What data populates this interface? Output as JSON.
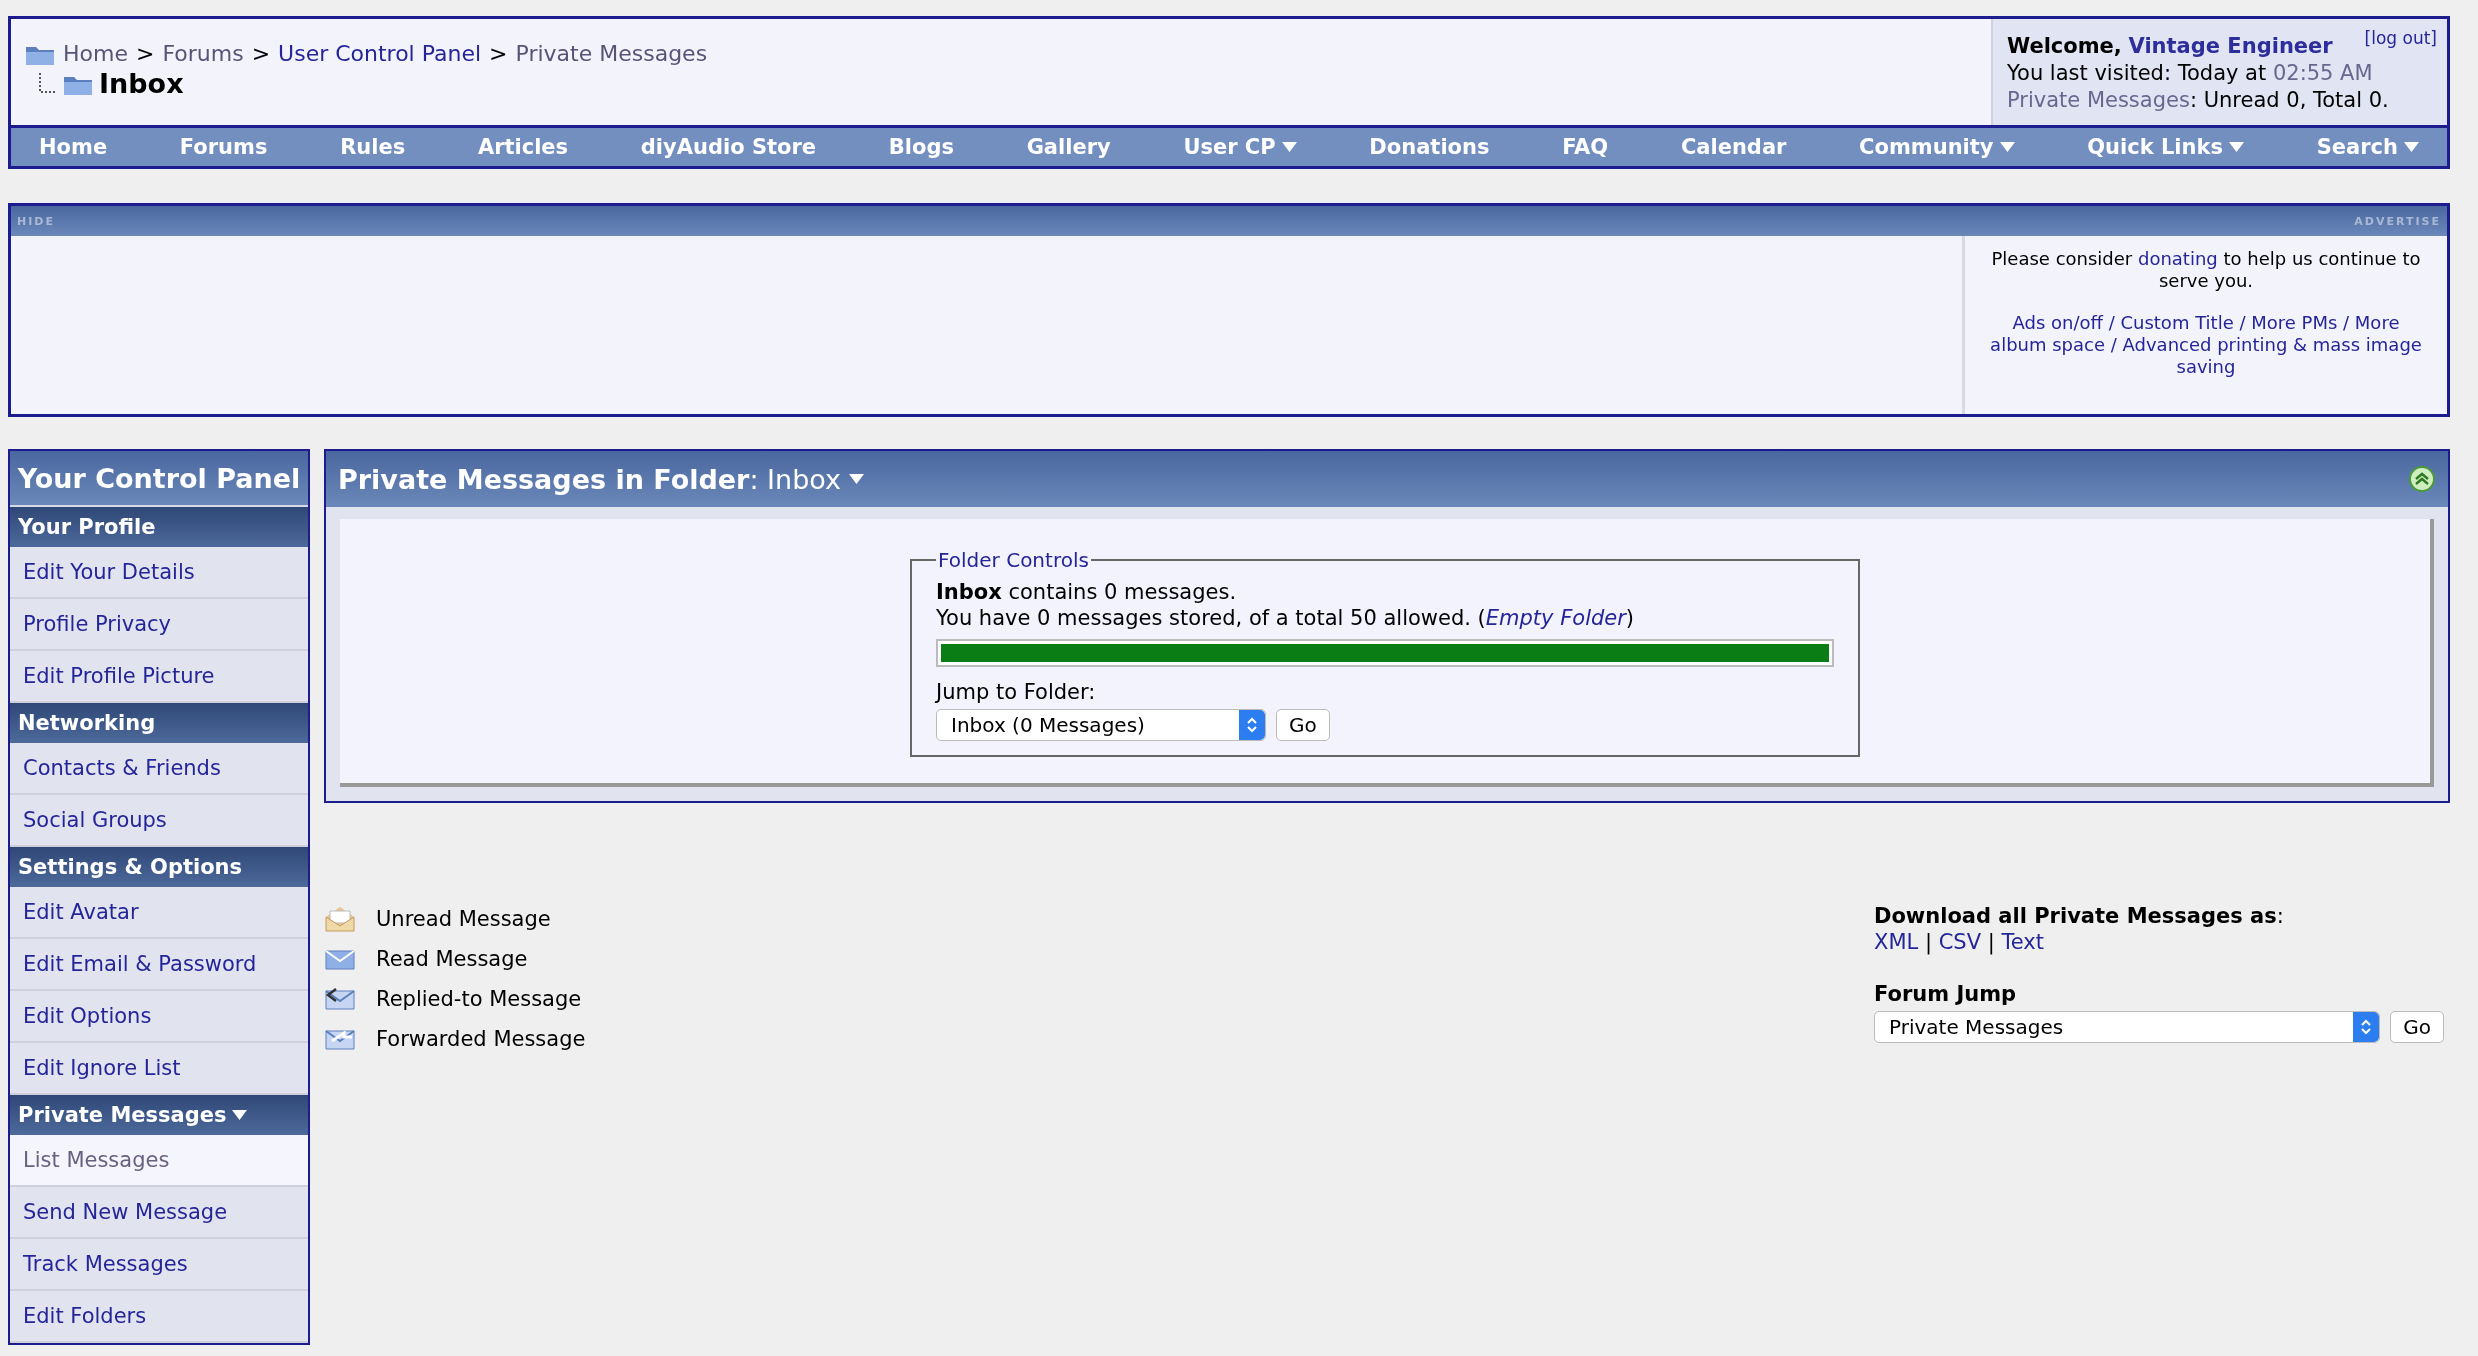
{
  "breadcrumb": {
    "separator": ">",
    "items": [
      {
        "label": "Home",
        "visited": true
      },
      {
        "label": "Forums",
        "visited": true
      },
      {
        "label": "User Control Panel",
        "visited": false
      },
      {
        "label": "Private Messages",
        "visited": true
      }
    ],
    "page_title": "Inbox"
  },
  "welcome": {
    "greeting": "Welcome,",
    "name": "Vintage Engineer",
    "logout": "[log out]",
    "last_visited": "You last visited: Today at",
    "time": "02:55 AM",
    "pm_link": "Private Messages",
    "pm_status": ": Unread 0, Total 0."
  },
  "nav": [
    {
      "label": "Home",
      "dropdown": false
    },
    {
      "label": "Forums",
      "dropdown": false
    },
    {
      "label": "Rules",
      "dropdown": false
    },
    {
      "label": "Articles",
      "dropdown": false
    },
    {
      "label": "diyAudio Store",
      "dropdown": false
    },
    {
      "label": "Blogs",
      "dropdown": false
    },
    {
      "label": "Gallery",
      "dropdown": false
    },
    {
      "label": "User CP",
      "dropdown": true
    },
    {
      "label": "Donations",
      "dropdown": false
    },
    {
      "label": "FAQ",
      "dropdown": false
    },
    {
      "label": "Calendar",
      "dropdown": false
    },
    {
      "label": "Community",
      "dropdown": true
    },
    {
      "label": "Quick Links",
      "dropdown": true
    },
    {
      "label": "Search",
      "dropdown": true
    }
  ],
  "ad": {
    "hide": "HIDE",
    "advertise": "ADVERTISE",
    "donate_before": "Please consider ",
    "donate_link": "donating",
    "donate_after": " to help us continue to serve you.",
    "perks": "Ads on/off / Custom Title / More PMs / More album space / Advanced printing & mass image saving"
  },
  "sidebar": {
    "title": "Your Control Panel",
    "sections": [
      {
        "label": "Your Profile",
        "dropdown": false,
        "items": [
          {
            "label": "Edit Your Details",
            "selected": false
          },
          {
            "label": "Profile Privacy",
            "selected": false
          },
          {
            "label": "Edit Profile Picture",
            "selected": false
          }
        ]
      },
      {
        "label": "Networking",
        "dropdown": false,
        "items": [
          {
            "label": "Contacts & Friends",
            "selected": false
          },
          {
            "label": "Social Groups",
            "selected": false
          }
        ]
      },
      {
        "label": "Settings & Options",
        "dropdown": false,
        "items": [
          {
            "label": "Edit Avatar",
            "selected": false
          },
          {
            "label": "Edit Email & Password",
            "selected": false
          },
          {
            "label": "Edit Options",
            "selected": false
          },
          {
            "label": "Edit Ignore List",
            "selected": false
          }
        ]
      },
      {
        "label": "Private Messages",
        "dropdown": true,
        "items": [
          {
            "label": "List Messages",
            "selected": true
          },
          {
            "label": "Send New Message",
            "selected": false
          },
          {
            "label": "Track Messages",
            "selected": false
          },
          {
            "label": "Edit Folders",
            "selected": false
          }
        ]
      }
    ]
  },
  "panel": {
    "title": "**Private Messages in Folder**: Inbox",
    "fieldset": "Folder Controls",
    "contains": "**Inbox** contains 0 messages.",
    "stored_before": "You have 0 messages stored, of a total 50 allowed. (",
    "empty_link": "Empty Folder",
    "stored_after": ")",
    "level": 1,
    "jump_label": "Jump to Folder:",
    "jump_value": "Inbox (0 Messages)",
    "go": "Go"
  },
  "legend": [
    {
      "label": "Unread Message",
      "kind": "unread"
    },
    {
      "label": "Read Message",
      "kind": "read"
    },
    {
      "label": "Replied-to Message",
      "kind": "replied"
    },
    {
      "label": "Forwarded Message",
      "kind": "forwarded"
    }
  ],
  "download": {
    "title": "**Download all Private Messages as**:",
    "formats": [
      "XML",
      "CSV",
      "Text"
    ],
    "separator": "|"
  },
  "forum_jump": {
    "title": "Forum Jump",
    "value": "Private Messages",
    "go": "Go"
  }
}
